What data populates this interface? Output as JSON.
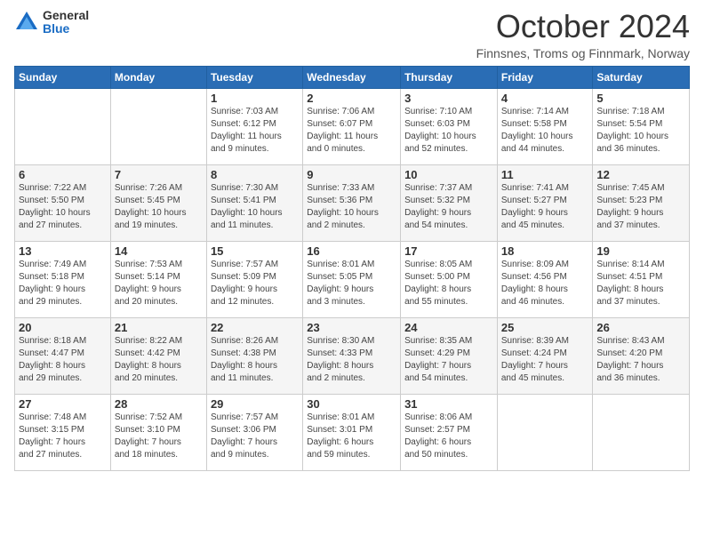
{
  "header": {
    "logo_general": "General",
    "logo_blue": "Blue",
    "month_title": "October 2024",
    "location": "Finnsnes, Troms og Finnmark, Norway"
  },
  "weekdays": [
    "Sunday",
    "Monday",
    "Tuesday",
    "Wednesday",
    "Thursday",
    "Friday",
    "Saturday"
  ],
  "weeks": [
    [
      {
        "day": "",
        "info": ""
      },
      {
        "day": "",
        "info": ""
      },
      {
        "day": "1",
        "info": "Sunrise: 7:03 AM\nSunset: 6:12 PM\nDaylight: 11 hours\nand 9 minutes."
      },
      {
        "day": "2",
        "info": "Sunrise: 7:06 AM\nSunset: 6:07 PM\nDaylight: 11 hours\nand 0 minutes."
      },
      {
        "day": "3",
        "info": "Sunrise: 7:10 AM\nSunset: 6:03 PM\nDaylight: 10 hours\nand 52 minutes."
      },
      {
        "day": "4",
        "info": "Sunrise: 7:14 AM\nSunset: 5:58 PM\nDaylight: 10 hours\nand 44 minutes."
      },
      {
        "day": "5",
        "info": "Sunrise: 7:18 AM\nSunset: 5:54 PM\nDaylight: 10 hours\nand 36 minutes."
      }
    ],
    [
      {
        "day": "6",
        "info": "Sunrise: 7:22 AM\nSunset: 5:50 PM\nDaylight: 10 hours\nand 27 minutes."
      },
      {
        "day": "7",
        "info": "Sunrise: 7:26 AM\nSunset: 5:45 PM\nDaylight: 10 hours\nand 19 minutes."
      },
      {
        "day": "8",
        "info": "Sunrise: 7:30 AM\nSunset: 5:41 PM\nDaylight: 10 hours\nand 11 minutes."
      },
      {
        "day": "9",
        "info": "Sunrise: 7:33 AM\nSunset: 5:36 PM\nDaylight: 10 hours\nand 2 minutes."
      },
      {
        "day": "10",
        "info": "Sunrise: 7:37 AM\nSunset: 5:32 PM\nDaylight: 9 hours\nand 54 minutes."
      },
      {
        "day": "11",
        "info": "Sunrise: 7:41 AM\nSunset: 5:27 PM\nDaylight: 9 hours\nand 45 minutes."
      },
      {
        "day": "12",
        "info": "Sunrise: 7:45 AM\nSunset: 5:23 PM\nDaylight: 9 hours\nand 37 minutes."
      }
    ],
    [
      {
        "day": "13",
        "info": "Sunrise: 7:49 AM\nSunset: 5:18 PM\nDaylight: 9 hours\nand 29 minutes."
      },
      {
        "day": "14",
        "info": "Sunrise: 7:53 AM\nSunset: 5:14 PM\nDaylight: 9 hours\nand 20 minutes."
      },
      {
        "day": "15",
        "info": "Sunrise: 7:57 AM\nSunset: 5:09 PM\nDaylight: 9 hours\nand 12 minutes."
      },
      {
        "day": "16",
        "info": "Sunrise: 8:01 AM\nSunset: 5:05 PM\nDaylight: 9 hours\nand 3 minutes."
      },
      {
        "day": "17",
        "info": "Sunrise: 8:05 AM\nSunset: 5:00 PM\nDaylight: 8 hours\nand 55 minutes."
      },
      {
        "day": "18",
        "info": "Sunrise: 8:09 AM\nSunset: 4:56 PM\nDaylight: 8 hours\nand 46 minutes."
      },
      {
        "day": "19",
        "info": "Sunrise: 8:14 AM\nSunset: 4:51 PM\nDaylight: 8 hours\nand 37 minutes."
      }
    ],
    [
      {
        "day": "20",
        "info": "Sunrise: 8:18 AM\nSunset: 4:47 PM\nDaylight: 8 hours\nand 29 minutes."
      },
      {
        "day": "21",
        "info": "Sunrise: 8:22 AM\nSunset: 4:42 PM\nDaylight: 8 hours\nand 20 minutes."
      },
      {
        "day": "22",
        "info": "Sunrise: 8:26 AM\nSunset: 4:38 PM\nDaylight: 8 hours\nand 11 minutes."
      },
      {
        "day": "23",
        "info": "Sunrise: 8:30 AM\nSunset: 4:33 PM\nDaylight: 8 hours\nand 2 minutes."
      },
      {
        "day": "24",
        "info": "Sunrise: 8:35 AM\nSunset: 4:29 PM\nDaylight: 7 hours\nand 54 minutes."
      },
      {
        "day": "25",
        "info": "Sunrise: 8:39 AM\nSunset: 4:24 PM\nDaylight: 7 hours\nand 45 minutes."
      },
      {
        "day": "26",
        "info": "Sunrise: 8:43 AM\nSunset: 4:20 PM\nDaylight: 7 hours\nand 36 minutes."
      }
    ],
    [
      {
        "day": "27",
        "info": "Sunrise: 7:48 AM\nSunset: 3:15 PM\nDaylight: 7 hours\nand 27 minutes."
      },
      {
        "day": "28",
        "info": "Sunrise: 7:52 AM\nSunset: 3:10 PM\nDaylight: 7 hours\nand 18 minutes."
      },
      {
        "day": "29",
        "info": "Sunrise: 7:57 AM\nSunset: 3:06 PM\nDaylight: 7 hours\nand 9 minutes."
      },
      {
        "day": "30",
        "info": "Sunrise: 8:01 AM\nSunset: 3:01 PM\nDaylight: 6 hours\nand 59 minutes."
      },
      {
        "day": "31",
        "info": "Sunrise: 8:06 AM\nSunset: 2:57 PM\nDaylight: 6 hours\nand 50 minutes."
      },
      {
        "day": "",
        "info": ""
      },
      {
        "day": "",
        "info": ""
      }
    ]
  ]
}
